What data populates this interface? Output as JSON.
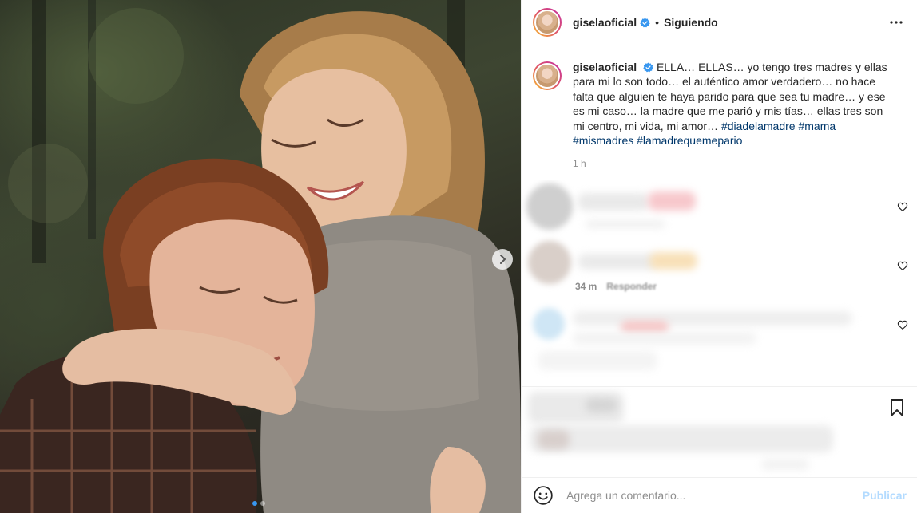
{
  "post": {
    "username": "giselaoficial",
    "verified": true,
    "separator": "•",
    "follow_status": "Siguiendo",
    "more_icon": "more-horizontal-icon",
    "image_description_icon": "photo",
    "carousel": {
      "total": 2,
      "current": 1
    }
  },
  "caption": {
    "username": "giselaoficial",
    "text": "ELLA… ELLAS… yo tengo tres madres y ellas para mi lo son todo… el auténtico amor verdadero… no hace falta que alguien te haya parido para que sea tu madre… y ese es mi caso… la madre que me parió y mis tías… ellas tres son mi centro, mi vida, mi amor… ",
    "hashtags": [
      "#diadelamadre",
      "#mama",
      "#mismadres",
      "#lamadrequemepario"
    ],
    "time": "1 h"
  },
  "comments": {
    "visible_meta": {
      "time": "34 m",
      "reply_label": "Responder"
    }
  },
  "composer": {
    "placeholder": "Agrega un comentario...",
    "post_label": "Publicar",
    "emoji_icon": "emoji-icon"
  },
  "colors": {
    "link": "#00376b",
    "verified": "#3897f0",
    "muted": "#8e8e8e",
    "publish_disabled": "#b3dbff",
    "story_ring": [
      "#f9c22e",
      "#e15b64",
      "#c32aa3"
    ]
  }
}
